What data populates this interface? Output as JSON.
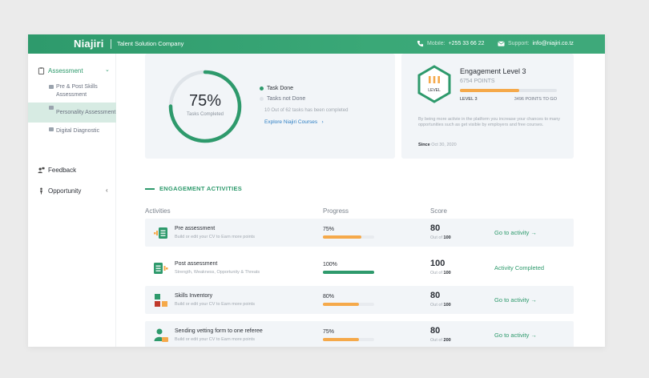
{
  "header": {
    "logo": "Niajiri",
    "tagline": "Talent Solution Company",
    "mobile_label": "Mobile:",
    "mobile_value": "+255 33 66 22",
    "support_label": "Support:",
    "support_value": "info@niajiri.co.tz",
    "color": "#3aa877"
  },
  "sidebar": {
    "assessment": "Assessment",
    "sub_items": [
      "Pre & Post Skills Assessment",
      "Personality Assessment",
      "Digital Diagnostic"
    ],
    "feedback": "Feedback",
    "opportunity": "Opportunity",
    "active_sub": "Personality Assessment"
  },
  "tasks": {
    "percent": 75,
    "percent_label": "75%",
    "sub_label": "Tasks Completed",
    "legend_done": "Task Done",
    "legend_not_done": "Tasks not Done",
    "note": "10 Out of 62 tasks has been completed",
    "explore": "Explore Niajiri Courses",
    "done_color": "#2e9a6c",
    "not_done_color": "#dfe4e9"
  },
  "engagement": {
    "badge_numeral": "III",
    "badge_text": "LEVEL",
    "title": "Engagement Level 3",
    "points": "6754 POINTS",
    "progress": 0.61,
    "level": "LEVEL 3",
    "to_go": "3496 POINTS TO GO",
    "description": "By being more activie in the platform you increase your chances to many opportunities such as get visible by employers and free courses.",
    "since_label": "Since",
    "since_date": "Oct 30, 2020"
  },
  "activities": {
    "section_title": "ENGAGEMENT ACTIVITIES",
    "columns": [
      "Activities",
      "Progress",
      "Score"
    ],
    "rows": [
      {
        "icon": "checklist-icon",
        "title": "Pre assessment",
        "desc": "Build or edit your CV to Earn more points",
        "progress_label": "75%",
        "progress": 0.75,
        "bar_color": "#f5a94a",
        "score": "80",
        "outof_prefix": "Out of",
        "outof": "100",
        "action": "Go to activity  →"
      },
      {
        "icon": "clipboard-icon",
        "title": "Post assessment",
        "desc": "Strength, Weakness, Opportunity & Threats",
        "progress_label": "100%",
        "progress": 1.0,
        "bar_color": "#2e9a6c",
        "score": "100",
        "outof_prefix": "Out of",
        "outof": "100",
        "action": "Activity Completed"
      },
      {
        "icon": "blocks-icon",
        "title": "Skills Inventory",
        "desc": "Build or edit your CV to Earn more points",
        "progress_label": "80%",
        "progress": 0.7,
        "bar_color": "#f5a94a",
        "score": "80",
        "outof_prefix": "Out of",
        "outof": "100",
        "action": "Go to activity  →"
      },
      {
        "icon": "person-icon",
        "title": "Sending vetting form to one referee",
        "desc": "Build or edit your CV to Earn more points",
        "progress_label": "75%",
        "progress": 0.7,
        "bar_color": "#f5a94a",
        "score": "80",
        "outof_prefix": "Out of",
        "outof": "200",
        "action": "Go to activity  →"
      }
    ]
  }
}
